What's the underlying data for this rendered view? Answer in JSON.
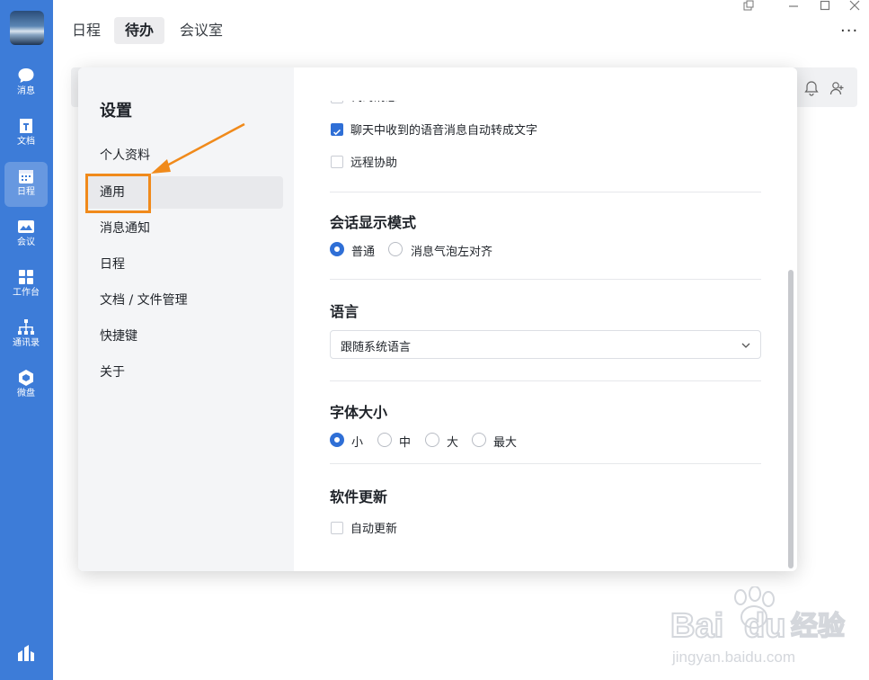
{
  "sidebar": {
    "items": [
      {
        "label": "消息",
        "icon": "chat-bubble-icon"
      },
      {
        "label": "文档",
        "icon": "document-icon"
      },
      {
        "label": "日程",
        "icon": "calendar-icon"
      },
      {
        "label": "会议",
        "icon": "meeting-icon"
      },
      {
        "label": "工作台",
        "icon": "grid-icon"
      },
      {
        "label": "通讯录",
        "icon": "org-chart-icon"
      },
      {
        "label": "微盘",
        "icon": "cloud-drive-icon"
      }
    ],
    "active_index": 2
  },
  "header": {
    "tabs": [
      "日程",
      "待办",
      "会议室"
    ],
    "active_tab": "待办",
    "more": "···"
  },
  "dialog": {
    "title": "设置",
    "menu": [
      "个人资料",
      "通用",
      "消息通知",
      "日程",
      "文档 / 文件管理",
      "快捷键",
      "关于"
    ],
    "active_menu": "通用",
    "content": {
      "partial_option": "代码消息",
      "options_top": [
        {
          "label": "聊天中收到的语音消息自动转成文字",
          "checked": true
        },
        {
          "label": "远程协助",
          "checked": false
        }
      ],
      "display_mode": {
        "title": "会话显示模式",
        "options": [
          {
            "label": "普通",
            "selected": true
          },
          {
            "label": "消息气泡左对齐",
            "selected": false
          }
        ]
      },
      "language": {
        "title": "语言",
        "value": "跟随系统语言"
      },
      "font_size": {
        "title": "字体大小",
        "options": [
          {
            "label": "小",
            "selected": true
          },
          {
            "label": "中",
            "selected": false
          },
          {
            "label": "大",
            "selected": false
          },
          {
            "label": "最大",
            "selected": false
          }
        ]
      },
      "update": {
        "title": "软件更新",
        "option": {
          "label": "自动更新",
          "checked": false
        }
      }
    }
  },
  "watermark": {
    "brand": "Bai",
    "brand2": "du",
    "cn": "经验",
    "url": "jingyan.baidu.com"
  },
  "colors": {
    "rail": "#3d7cd8",
    "accent": "#2f6fd6",
    "annotation": "#f08a1b"
  }
}
